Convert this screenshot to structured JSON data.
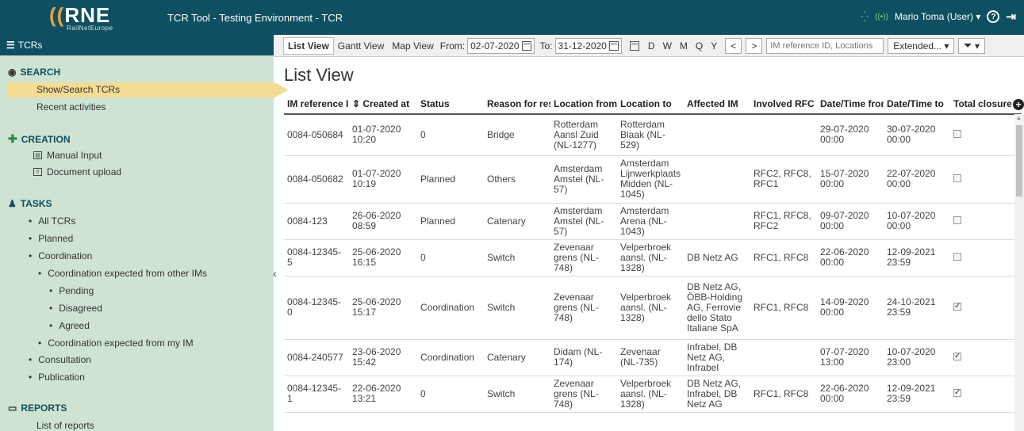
{
  "header": {
    "logo_text": "RNE",
    "logo_sub": "RailNetEurope",
    "app_title": "TCR Tool - Testing Environment  -  TCR",
    "user": "Mario Toma (User) ▾",
    "help": "?"
  },
  "sidebar": {
    "title": "TCRs",
    "search": {
      "title": "SEARCH",
      "items": [
        "Show/Search TCRs",
        "Recent activities"
      ]
    },
    "creation": {
      "title": "CREATION",
      "items": [
        "Manual Input",
        "Document upload"
      ]
    },
    "tasks": {
      "title": "TASKS",
      "items": [
        "All TCRs",
        "Planned",
        "Coordination",
        "Coordination expected from other IMs",
        "Pending",
        "Disagreed",
        "Agreed",
        "Coordination expected from my IM",
        "Consultation",
        "Publication"
      ]
    },
    "reports": {
      "title": "REPORTS",
      "items": [
        "List of reports"
      ]
    }
  },
  "toolbar": {
    "views": [
      "List View",
      "Gantt View",
      "Map View"
    ],
    "from_label": "From:",
    "from_value": "02-07-2020",
    "to_label": "To:",
    "to_value": "31-12-2020",
    "periods": [
      "D",
      "W",
      "M",
      "Q",
      "Y"
    ],
    "prev": "<",
    "next": ">",
    "search_placeholder": "IM reference ID, Locations",
    "extended": "Extended... ▾",
    "filter": "▾"
  },
  "main": {
    "title": "List View",
    "columns": [
      "IM reference ID",
      "⇕ Created at",
      "Status",
      "Reason for restriction",
      "Location from",
      "Location to",
      "Affected IM",
      "Involved RFC",
      "Date/Time from",
      "Date/Time to",
      "Total closure"
    ],
    "rows": [
      {
        "id": "0084-050684",
        "created": "01-07-2020 10:20",
        "status": "0",
        "reason": "Bridge",
        "from": "Rotterdam Aansl Zuid (NL-1277)",
        "to": "Rotterdam Blaak (NL-529)",
        "im": "",
        "rfc": "",
        "dfrom": "29-07-2020 00:00",
        "dto": "30-07-2020 00:00",
        "closure": false
      },
      {
        "id": "0084-050682",
        "created": "01-07-2020 10:19",
        "status": "Planned",
        "reason": "Others",
        "from": "Amsterdam Amstel (NL-57)",
        "to": "Amsterdam Lijnwerkplaats Midden (NL-1045)",
        "im": "",
        "rfc": "RFC2, RFC8, RFC1",
        "dfrom": "15-07-2020 00:00",
        "dto": "22-07-2020 00:00",
        "closure": false
      },
      {
        "id": "0084-123",
        "created": "26-06-2020 08:59",
        "status": "Planned",
        "reason": "Catenary",
        "from": "Amsterdam Amstel (NL-57)",
        "to": "Amsterdam Arena (NL-1043)",
        "im": "",
        "rfc": "RFC1, RFC8, RFC2",
        "dfrom": "09-07-2020 00:00",
        "dto": "10-07-2020 00:00",
        "closure": false
      },
      {
        "id": "0084-12345-5",
        "created": "25-06-2020 16:15",
        "status": "0",
        "reason": "Switch",
        "from": "Zevenaar grens (NL-748)",
        "to": "Velperbroek aansl. (NL-1328)",
        "im": "DB Netz AG",
        "rfc": "RFC1, RFC8",
        "dfrom": "22-06-2020 00:00",
        "dto": "12-09-2021 23:59",
        "closure": false
      },
      {
        "id": "0084-12345-0",
        "created": "25-06-2020 15:17",
        "status": "Coordination",
        "reason": "Switch",
        "from": "Zevenaar grens (NL-748)",
        "to": "Velperbroek aansl. (NL-1328)",
        "im": "DB Netz AG, ÖBB-Holding AG, Ferrovie dello Stato Italiane SpA",
        "rfc": "RFC1, RFC8",
        "dfrom": "14-09-2020 00:00",
        "dto": "24-10-2021 23:59",
        "closure": true
      },
      {
        "id": "0084-240577",
        "created": "23-06-2020 15:42",
        "status": "Coordination",
        "reason": "Catenary",
        "from": "Didam (NL-174)",
        "to": "Zevenaar (NL-735)",
        "im": "Infrabel, DB Netz AG, Infrabel",
        "rfc": "",
        "dfrom": "07-07-2020 13:00",
        "dto": "10-07-2020 23:00",
        "closure": true
      },
      {
        "id": "0084-12345-1",
        "created": "22-06-2020 13:21",
        "status": "0",
        "reason": "Switch",
        "from": "Zevenaar grens (NL-748)",
        "to": "Velperbroek aansl. (NL-1328)",
        "im": "DB Netz AG, Infrabel, DB Netz AG",
        "rfc": "RFC1, RFC8",
        "dfrom": "22-06-2020 00:00",
        "dto": "12-09-2021 23:59",
        "closure": true
      }
    ]
  },
  "colors": {
    "header_bg": "#0e4f61",
    "sidebar_bg": "#cfe3d3",
    "active_item": "#f5dc94",
    "logo_accent": "#e2a14a"
  }
}
